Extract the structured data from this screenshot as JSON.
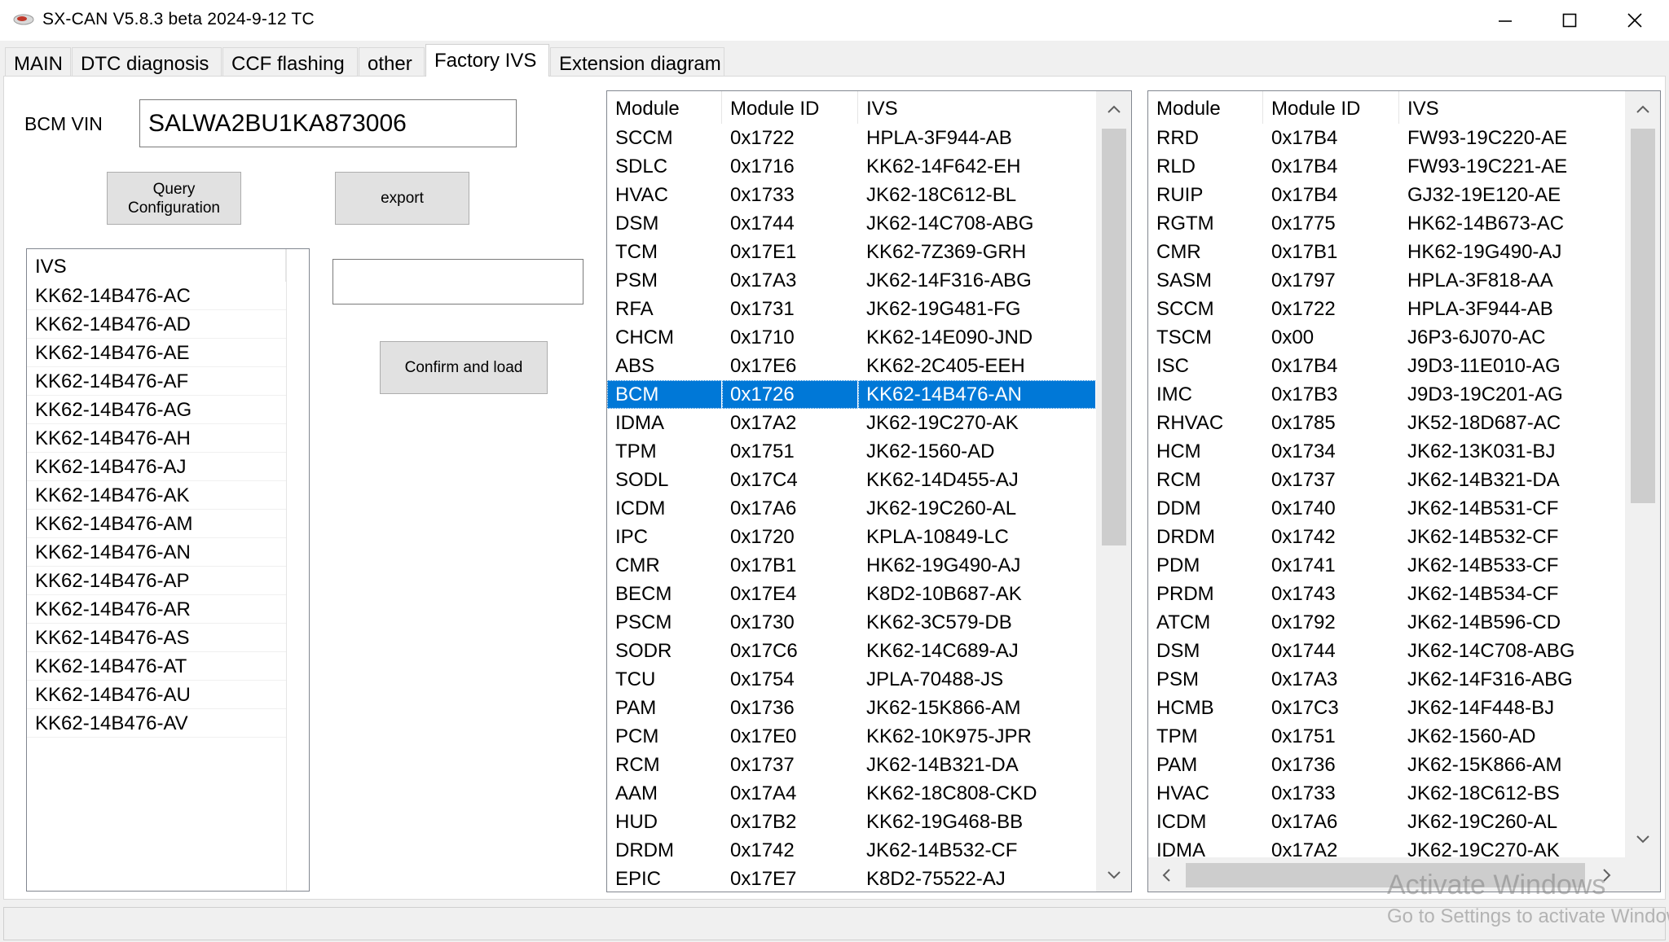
{
  "window": {
    "title": "SX-CAN V5.8.3 beta 2024-9-12 TC"
  },
  "tabs": [
    {
      "label": "MAIN"
    },
    {
      "label": "DTC diagnosis"
    },
    {
      "label": "CCF flashing"
    },
    {
      "label": "other"
    },
    {
      "label": "Factory IVS",
      "active": true
    },
    {
      "label": "Extension diagram"
    }
  ],
  "bcm_vin": {
    "label": "BCM VIN",
    "value": "SALWA2BU1KA873006"
  },
  "buttons": {
    "query_line1": "Query",
    "query_line2": "Configuration",
    "export": "export",
    "confirm_load": "Confirm and load"
  },
  "ivs_list": {
    "header": "IVS",
    "items": [
      "KK62-14B476-AC",
      "KK62-14B476-AD",
      "KK62-14B476-AE",
      "KK62-14B476-AF",
      "KK62-14B476-AG",
      "KK62-14B476-AH",
      "KK62-14B476-AJ",
      "KK62-14B476-AK",
      "KK62-14B476-AM",
      "KK62-14B476-AN",
      "KK62-14B476-AP",
      "KK62-14B476-AR",
      "KK62-14B476-AS",
      "KK62-14B476-AT",
      "KK62-14B476-AU",
      "KK62-14B476-AV"
    ]
  },
  "modules_table": {
    "headers": [
      "Module",
      "Module ID",
      "IVS"
    ],
    "selected_index": 9,
    "rows": [
      [
        "SCCM",
        "0x1722",
        "HPLA-3F944-AB"
      ],
      [
        "SDLC",
        "0x1716",
        "KK62-14F642-EH"
      ],
      [
        "HVAC",
        "0x1733",
        "JK62-18C612-BL"
      ],
      [
        "DSM",
        "0x1744",
        "JK62-14C708-ABG"
      ],
      [
        "TCM",
        "0x17E1",
        "KK62-7Z369-GRH"
      ],
      [
        "PSM",
        "0x17A3",
        "JK62-14F316-ABG"
      ],
      [
        "RFA",
        "0x1731",
        "JK62-19G481-FG"
      ],
      [
        "CHCM",
        "0x1710",
        "KK62-14E090-JND"
      ],
      [
        "ABS",
        "0x17E6",
        "KK62-2C405-EEH"
      ],
      [
        "BCM",
        "0x1726",
        "KK62-14B476-AN"
      ],
      [
        "IDMA",
        "0x17A2",
        "JK62-19C270-AK"
      ],
      [
        "TPM",
        "0x1751",
        "JK62-1560-AD"
      ],
      [
        "SODL",
        "0x17C4",
        "KK62-14D455-AJ"
      ],
      [
        "ICDM",
        "0x17A6",
        "JK62-19C260-AL"
      ],
      [
        "IPC",
        "0x1720",
        "KPLA-10849-LC"
      ],
      [
        "CMR",
        "0x17B1",
        "HK62-19G490-AJ"
      ],
      [
        "BECM",
        "0x17E4",
        "K8D2-10B687-AK"
      ],
      [
        "PSCM",
        "0x1730",
        "KK62-3C579-DB"
      ],
      [
        "SODR",
        "0x17C6",
        "KK62-14C689-AJ"
      ],
      [
        "TCU",
        "0x1754",
        "JPLA-70488-JS"
      ],
      [
        "PAM",
        "0x1736",
        "JK62-15K866-AM"
      ],
      [
        "PCM",
        "0x17E0",
        "KK62-10K975-JPR"
      ],
      [
        "RCM",
        "0x1737",
        "JK62-14B321-DA"
      ],
      [
        "AAM",
        "0x17A4",
        "KK62-18C808-CKD"
      ],
      [
        "HUD",
        "0x17B2",
        "KK62-19G468-BB"
      ],
      [
        "DRDM",
        "0x1742",
        "JK62-14B532-CF"
      ],
      [
        "EPIC",
        "0x17E7",
        "K8D2-75522-AJ"
      ]
    ]
  },
  "factory_table": {
    "headers": [
      "Module",
      "Module ID",
      "IVS"
    ],
    "rows": [
      [
        "RRD",
        "0x17B4",
        "FW93-19C220-AE"
      ],
      [
        "RLD",
        "0x17B4",
        "FW93-19C221-AE"
      ],
      [
        "RUIP",
        "0x17B4",
        "GJ32-19E120-AE"
      ],
      [
        "RGTM",
        "0x1775",
        "HK62-14B673-AC"
      ],
      [
        "CMR",
        "0x17B1",
        "HK62-19G490-AJ"
      ],
      [
        "SASM",
        "0x1797",
        "HPLA-3F818-AA"
      ],
      [
        "SCCM",
        "0x1722",
        "HPLA-3F944-AB"
      ],
      [
        "TSCM",
        "0x00",
        "J6P3-6J070-AC"
      ],
      [
        "ISC",
        "0x17B4",
        "J9D3-11E010-AG"
      ],
      [
        "IMC",
        "0x17B3",
        "J9D3-19C201-AG"
      ],
      [
        "RHVAC",
        "0x1785",
        "JK52-18D687-AC"
      ],
      [
        "HCM",
        "0x1734",
        "JK62-13K031-BJ"
      ],
      [
        "RCM",
        "0x1737",
        "JK62-14B321-DA"
      ],
      [
        "DDM",
        "0x1740",
        "JK62-14B531-CF"
      ],
      [
        "DRDM",
        "0x1742",
        "JK62-14B532-CF"
      ],
      [
        "PDM",
        "0x1741",
        "JK62-14B533-CF"
      ],
      [
        "PRDM",
        "0x1743",
        "JK62-14B534-CF"
      ],
      [
        "ATCM",
        "0x1792",
        "JK62-14B596-CD"
      ],
      [
        "DSM",
        "0x1744",
        "JK62-14C708-ABG"
      ],
      [
        "PSM",
        "0x17A3",
        "JK62-14F316-ABG"
      ],
      [
        "HCMB",
        "0x17C3",
        "JK62-14F448-BJ"
      ],
      [
        "TPM",
        "0x1751",
        "JK62-1560-AD"
      ],
      [
        "PAM",
        "0x1736",
        "JK62-15K866-AM"
      ],
      [
        "HVAC",
        "0x1733",
        "JK62-18C612-BS"
      ],
      [
        "ICDM",
        "0x17A6",
        "JK62-19C260-AL"
      ],
      [
        "IDMA",
        "0x17A2",
        "JK62-19C270-AK"
      ]
    ]
  },
  "watermark": {
    "line1": "Activate Windows",
    "line2": "Go to Settings to activate Windows."
  },
  "colors": {
    "selection": "#0078d7",
    "window_bg": "#f0f0f0"
  },
  "icons": [
    "app-icon",
    "minimize-icon",
    "maximize-icon",
    "close-icon",
    "scroll-up-icon",
    "scroll-down-icon",
    "scroll-left-icon",
    "scroll-right-icon"
  ]
}
